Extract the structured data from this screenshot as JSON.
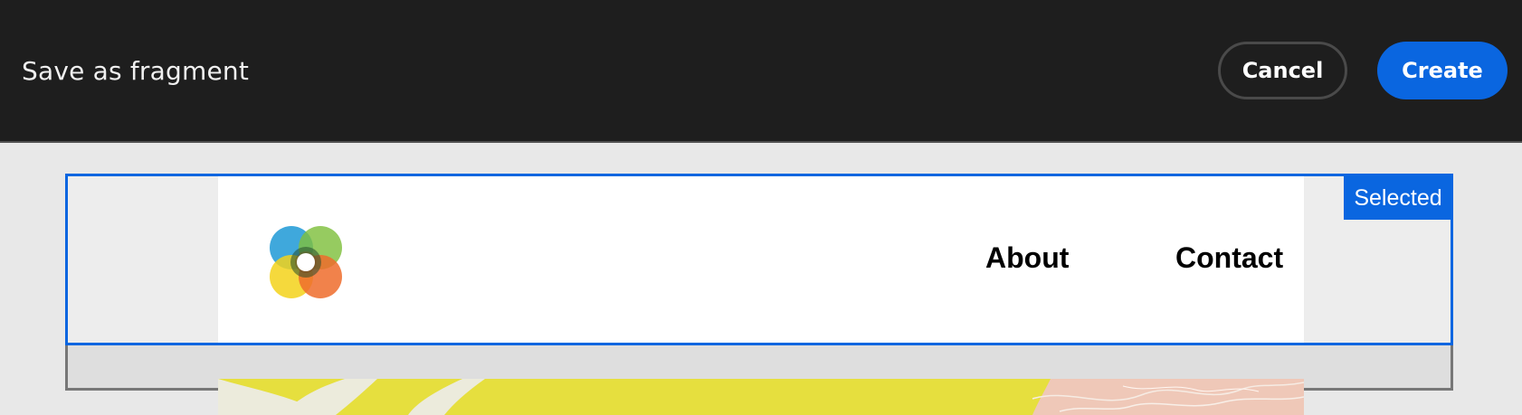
{
  "dialog": {
    "title": "Save as fragment",
    "cancel_label": "Cancel",
    "create_label": "Create"
  },
  "selection": {
    "badge_label": "Selected"
  },
  "preview_header": {
    "nav": [
      "About",
      "Contact"
    ]
  },
  "colors": {
    "topbar": "#1e1e1e",
    "accent": "#0a66e0",
    "canvas": "#e8e8e8",
    "preview": "#ffffff"
  },
  "icons": {
    "logo": "multicolor-flower-logo"
  }
}
